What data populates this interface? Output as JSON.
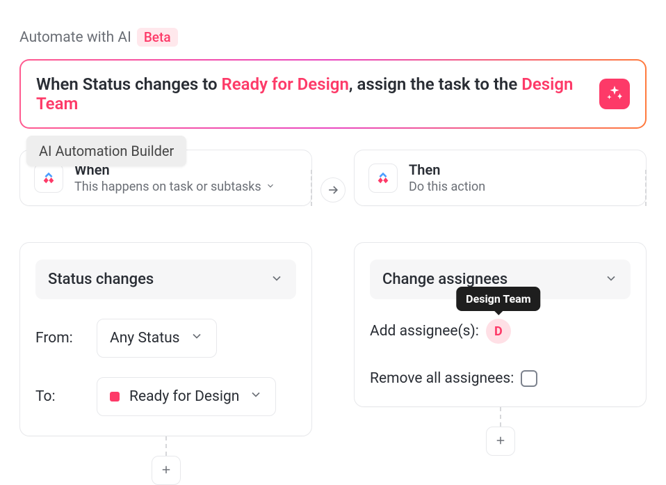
{
  "header": {
    "title": "Automate with AI",
    "badge": "Beta"
  },
  "prompt": {
    "prefix": "When Status changes to ",
    "hl1": "Ready for Design",
    "mid": ", assign the task to the ",
    "hl2": "Design Team"
  },
  "builder_tag": "AI Automation Builder",
  "when": {
    "title": "When",
    "subtitle": "This happens on task or subtasks",
    "trigger_type": "Status changes",
    "from_label": "From:",
    "from_value": "Any Status",
    "to_label": "To:",
    "to_value": "Ready for Design"
  },
  "then": {
    "title": "Then",
    "subtitle": "Do this action",
    "action_type": "Change assignees",
    "add_label": "Add assignee(s):",
    "assignee_initial": "D",
    "assignee_tooltip": "Design Team",
    "remove_label": "Remove all assignees:"
  }
}
